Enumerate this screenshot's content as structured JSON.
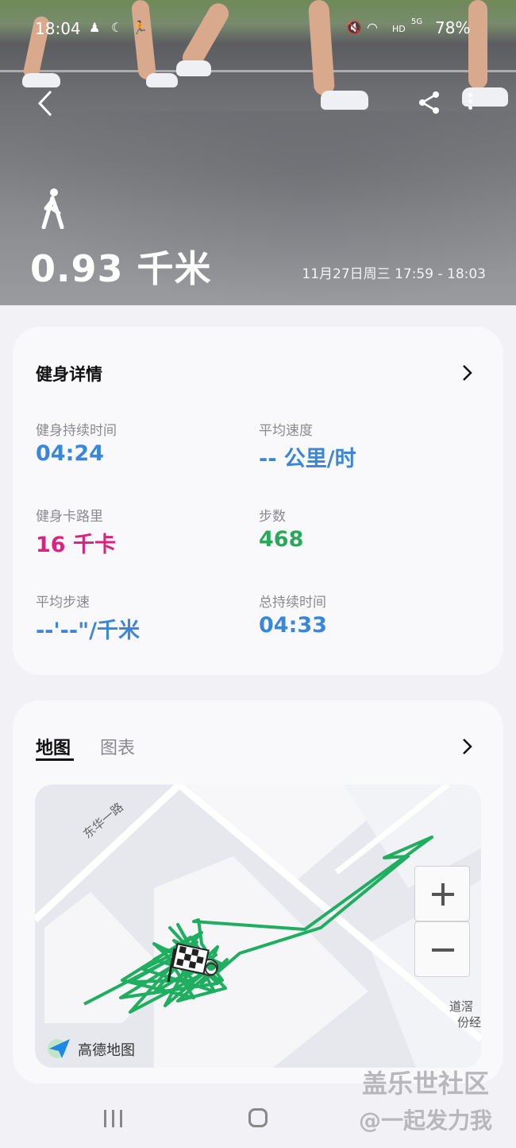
{
  "status_bar": {
    "time": "18:04",
    "network": "HD",
    "signal": "5G",
    "battery": "78%"
  },
  "hero": {
    "distance": "0.93 千米",
    "datetime": "11月27日周三 17:59 - 18:03",
    "activity_icon": "walking-person-icon"
  },
  "details": {
    "title": "健身详情",
    "stats": [
      {
        "label": "健身持续时间",
        "value": "04:24",
        "color": "#3a86d8"
      },
      {
        "label": "平均速度",
        "value": "-- 公里/时",
        "color": "#3a86d8"
      },
      {
        "label": "健身卡路里",
        "value": "16 千卡",
        "color": "#d8237f"
      },
      {
        "label": "步数",
        "value": "468",
        "color": "#2aa85a"
      },
      {
        "label": "平均步速",
        "value": "--'--\"/千米",
        "color": "#3a86d8"
      },
      {
        "label": "总持续时间",
        "value": "04:33",
        "color": "#3a86d8"
      }
    ]
  },
  "map_card": {
    "tabs": [
      {
        "label": "地图",
        "active": true
      },
      {
        "label": "图表",
        "active": false
      }
    ],
    "map": {
      "road_label": "东华一路",
      "right_label_1": "道滘",
      "right_label_2": "份经",
      "provider": "高德地图",
      "route_color": "#1fae5f"
    }
  },
  "watermark": {
    "line1": "盖乐世社区",
    "line2": "@一起发力我"
  }
}
